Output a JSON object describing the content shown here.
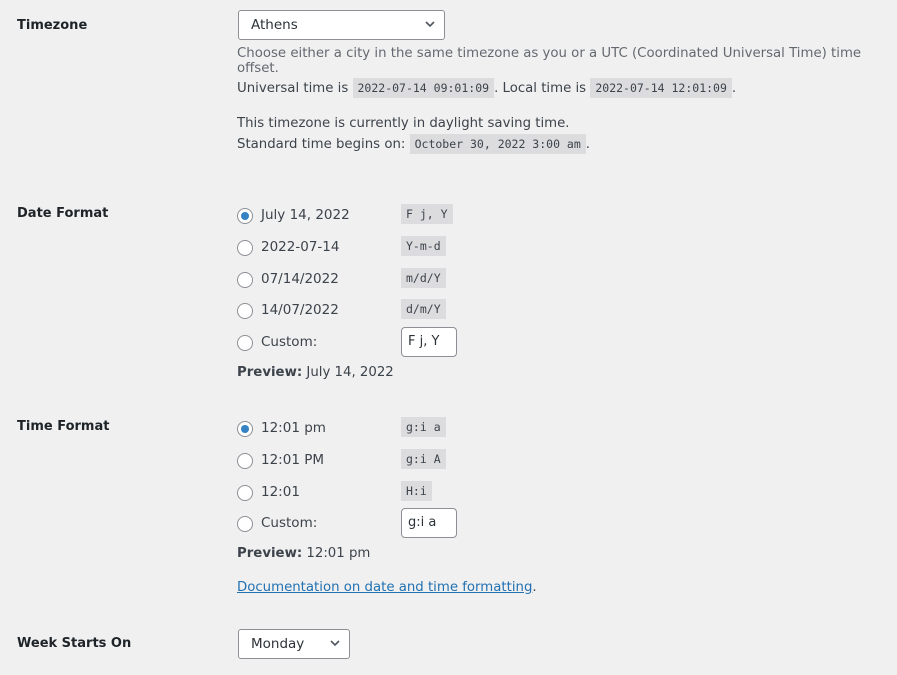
{
  "timezone": {
    "label": "Timezone",
    "selected": "Athens",
    "description": "Choose either a city in the same timezone as you or a UTC (Coordinated Universal Time) time offset.",
    "universal_prefix": "Universal time is",
    "universal_time": "2022-07-14 09:01:09",
    "local_prefix": ". Local time is",
    "local_time": "2022-07-14 12:01:09",
    "dst_text": "This timezone is currently in daylight saving time.",
    "standard_prefix": "Standard time begins on:",
    "standard_time": "October 30, 2022 3:00 am",
    "period": "."
  },
  "date_format": {
    "label": "Date Format",
    "options": [
      {
        "label": "July 14, 2022",
        "format": "F j, Y",
        "checked": true
      },
      {
        "label": "2022-07-14",
        "format": "Y-m-d",
        "checked": false
      },
      {
        "label": "07/14/2022",
        "format": "m/d/Y",
        "checked": false
      },
      {
        "label": "14/07/2022",
        "format": "d/m/Y",
        "checked": false
      }
    ],
    "custom_label": "Custom:",
    "custom_value": "F j, Y",
    "preview_label": "Preview:",
    "preview_value": "July 14, 2022"
  },
  "time_format": {
    "label": "Time Format",
    "options": [
      {
        "label": "12:01 pm",
        "format": "g:i a",
        "checked": true
      },
      {
        "label": "12:01 PM",
        "format": "g:i A",
        "checked": false
      },
      {
        "label": "12:01",
        "format": "H:i",
        "checked": false
      }
    ],
    "custom_label": "Custom:",
    "custom_value": "g:i a",
    "preview_label": "Preview:",
    "preview_value": "12:01 pm"
  },
  "documentation": {
    "link_text": "Documentation on date and time formatting",
    "suffix": "."
  },
  "week_starts_on": {
    "label": "Week Starts On",
    "selected": "Monday"
  }
}
